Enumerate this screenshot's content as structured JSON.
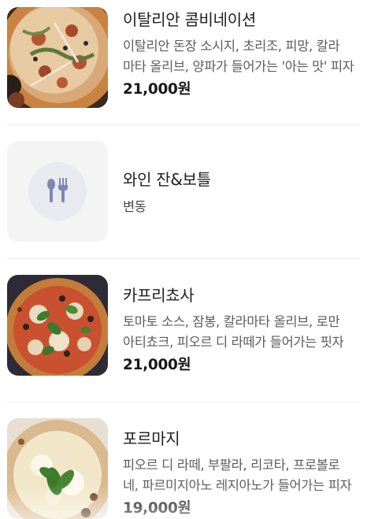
{
  "menu": {
    "items": [
      {
        "name": "이탈리안 콤비네이션",
        "desc_line1": "이탈리안 돈장 소시지, 초리조, 피망, 칼라",
        "desc_line2": "마타 올리브, 양파가 들어가는 '아는 맛' 피자",
        "price": "21,000원",
        "image": "pizza-combination"
      },
      {
        "name": "와인 잔&보틀",
        "price_text": "변동",
        "image": "placeholder-utensils-icon"
      },
      {
        "name": "카프리쵸사",
        "desc_line1": "토마토 소스, 잠봉, 칼라마타 올리브, 로만",
        "desc_line2": "아티쵸크, 피오르 디 라떼가 들어가는 핏자",
        "price": "21,000원",
        "image": "pizza-capricciosa"
      },
      {
        "name": "포르마지",
        "desc_line1": "피오르 디 라떼, 부팔라, 리코타, 프로볼로",
        "desc_line2": "네, 파르미지아노 레지아노가 들어가는 피자",
        "price": "19,000원",
        "image": "pizza-formaggi"
      }
    ]
  }
}
